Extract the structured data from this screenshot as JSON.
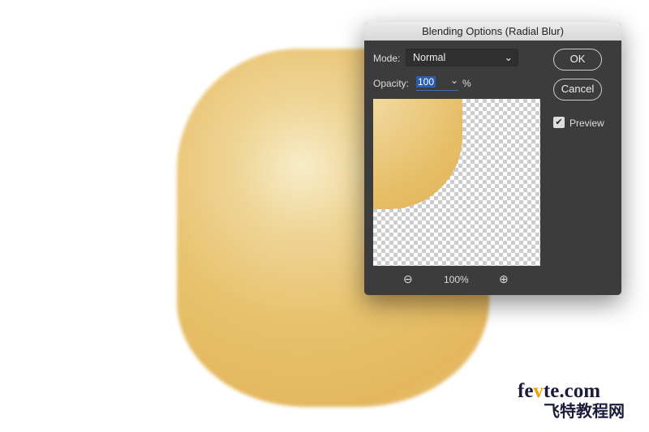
{
  "dialog": {
    "title": "Blending Options (Radial Blur)",
    "mode_label": "Mode:",
    "mode_value": "Normal",
    "opacity_label": "Opacity:",
    "opacity_value": "100",
    "percent": "%",
    "ok": "OK",
    "cancel": "Cancel",
    "preview_label": "Preview",
    "preview_checked": true,
    "zoom_level": "100%"
  },
  "watermark": {
    "line1_a": "fe",
    "line1_v": "v",
    "line1_b": "te.com",
    "line2": "飞特教程网"
  }
}
